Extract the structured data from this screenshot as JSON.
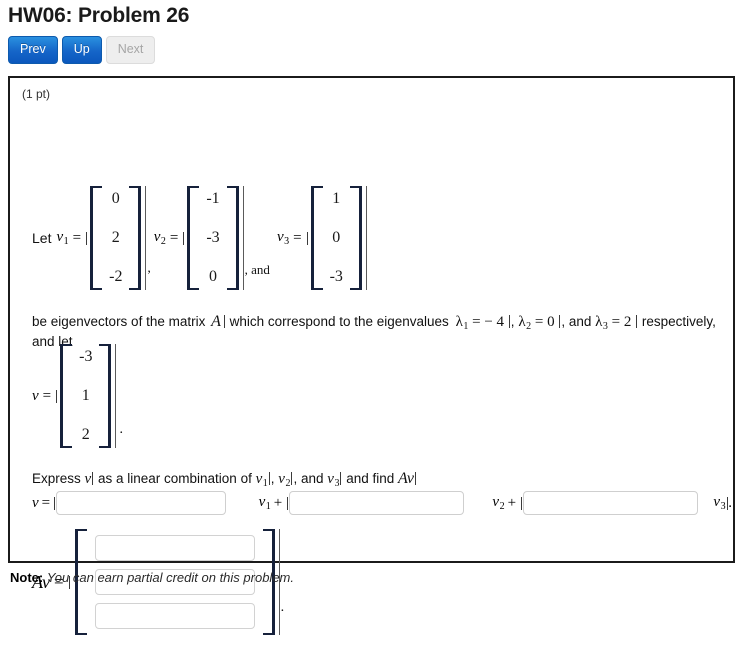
{
  "header": {
    "title": "HW06: Problem 26",
    "buttons": [
      {
        "label": "Prev",
        "state": "enabled"
      },
      {
        "label": "Up",
        "state": "enabled"
      },
      {
        "label": "Next",
        "state": "disabled"
      }
    ]
  },
  "problem": {
    "points": "(1 pt)",
    "lead_text": "Let",
    "vectors": [
      {
        "name": "v",
        "index": "1",
        "entries": [
          "0",
          "2",
          "-2"
        ]
      },
      {
        "name": "v",
        "index": "2",
        "entries": [
          "-1",
          "-3",
          "0"
        ]
      },
      {
        "name": "v",
        "index": "3",
        "entries": [
          "1",
          "0",
          "-3"
        ]
      }
    ],
    "vector_separator": ",",
    "and_word": ", and",
    "sentence": {
      "part1": "be eigenvectors of the matrix",
      "matrix_symbol": "A",
      "part2": "which correspond to the eigenvalues",
      "eigenvalues": [
        {
          "symbol": "λ",
          "index": "1",
          "value": "− 4"
        },
        {
          "symbol": "λ",
          "index": "2",
          "value": "0"
        },
        {
          "symbol": "λ",
          "index": "3",
          "value": "2"
        }
      ],
      "eig_sep": ",",
      "eig_and": ", and",
      "part3": "respectively, and let"
    },
    "v_vector": {
      "name": "v",
      "entries": [
        "-3",
        "1",
        "2"
      ],
      "trailing": "."
    },
    "instruction": {
      "prefix": "Express",
      "v_symbol": "v",
      "middle": "as a linear combination of",
      "list": [
        {
          "name": "v",
          "index": "1"
        },
        {
          "name": "v",
          "index": "2"
        },
        {
          "name": "v",
          "index": "3"
        }
      ],
      "list_sep": ",",
      "list_and": ", and",
      "suffix": "and find",
      "av_symbol": "Av"
    },
    "combination_row": {
      "lhs": "v",
      "equals": "=",
      "plus": "+",
      "coefficients": [
        {
          "value": "",
          "placeholder": "",
          "label_name": "v",
          "label_index": "1"
        },
        {
          "value": "",
          "placeholder": "",
          "label_name": "v",
          "label_index": "2"
        },
        {
          "value": "",
          "placeholder": "",
          "label_name": "v",
          "label_index": "3"
        }
      ],
      "trailing": "."
    },
    "av_row": {
      "lhs": "Av",
      "equals": "=",
      "entries": [
        {
          "value": "",
          "placeholder": ""
        },
        {
          "value": "",
          "placeholder": ""
        },
        {
          "value": "",
          "placeholder": ""
        }
      ],
      "trailing": "."
    }
  },
  "footer": {
    "note_label": "Note:",
    "note_text": "You can earn partial credit on this problem."
  },
  "colors": {
    "primary_button": "#1565c8",
    "panel_border": "#1b1b1b",
    "input_border": "#cfcfcf",
    "bracket": "#16213b"
  }
}
